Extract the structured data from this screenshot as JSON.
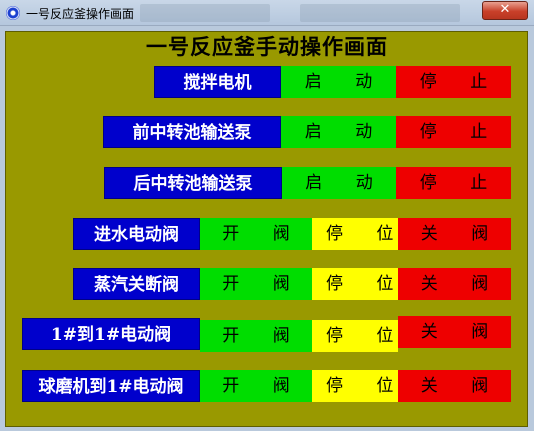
{
  "window": {
    "title": "一号反应釜操作画面",
    "close_label": "✕"
  },
  "heading": "一号反应釜手动操作画面",
  "rows": [
    {
      "label": "搅拌电机",
      "buttons": [
        "启 动",
        "停 止"
      ]
    },
    {
      "label": "前中转池输送泵",
      "buttons": [
        "启 动",
        "停 止"
      ]
    },
    {
      "label": "后中转池输送泵",
      "buttons": [
        "启 动",
        "停 止"
      ]
    },
    {
      "label": "进水电动阀",
      "buttons": [
        "开 阀",
        "停 位",
        "关 阀"
      ]
    },
    {
      "label": "蒸汽关断阀",
      "buttons": [
        "开 阀",
        "停 位",
        "关 阀"
      ]
    },
    {
      "label": "1#到1#电动阀",
      "buttons": [
        "开 阀",
        "停 位",
        "关 阀"
      ]
    },
    {
      "label": "球磨机到1#电动阀",
      "buttons": [
        "开 阀",
        "停 位",
        "关 阀"
      ]
    }
  ],
  "colors": {
    "panel": "#999900",
    "label_bg": "#0000cc",
    "start": "#00dd00",
    "hold": "#ffff00",
    "stop": "#ee0000"
  }
}
